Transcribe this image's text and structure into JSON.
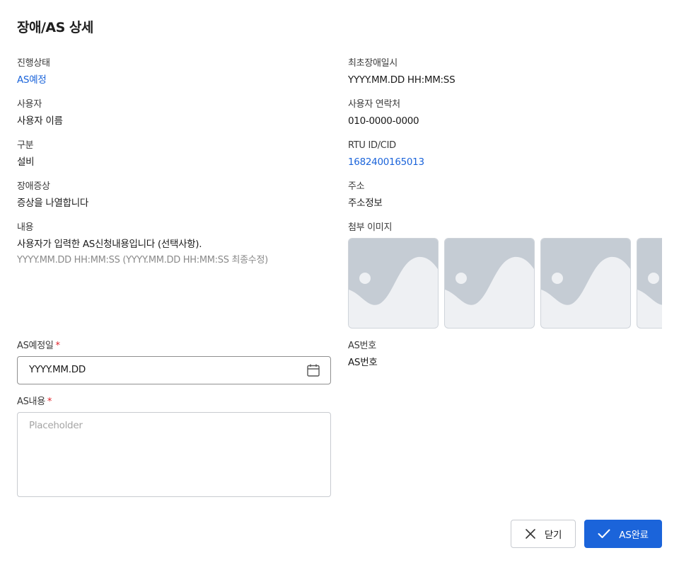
{
  "page_title": "장애/AS 상세",
  "left": {
    "status_label": "진행상태",
    "status_value": "AS예정",
    "user_label": "사용자",
    "user_value": "사용자 이름",
    "category_label": "구분",
    "category_value": "설비",
    "symptom_label": "장애증상",
    "symptom_value": "증상을 나열합니다",
    "content_label": "내용",
    "content_value": "사용자가 입력한 AS신청내용입니다 (선택사항).",
    "content_timestamp": "YYYY.MM.DD HH:MM:SS (YYYY.MM.DD HH:MM:SS 최종수정)"
  },
  "right": {
    "first_fault_label": "최초장애일시",
    "first_fault_value": "YYYY.MM.DD HH:MM:SS",
    "contact_label": "사용자 연락처",
    "contact_value": "010-0000-0000",
    "rtu_label": "RTU ID/CID",
    "rtu_value": "1682400165013",
    "address_label": "주소",
    "address_value": "주소정보",
    "attachments_label": "첨부 이미지",
    "attachments": [
      "image-placeholder",
      "image-placeholder",
      "image-placeholder",
      "image-placeholder"
    ],
    "as_number_label": "AS번호",
    "as_number_value": "AS번호"
  },
  "form": {
    "as_date_label": "AS예정일",
    "as_date_required": "*",
    "as_date_value": "YYYY.MM.DD",
    "as_content_label": "AS내용",
    "as_content_required": "*",
    "as_content_placeholder": "Placeholder"
  },
  "buttons": {
    "close_label": "닫기",
    "done_label": "AS완료"
  },
  "colors": {
    "accent": "#1b64da",
    "required": "#e0242a",
    "thumb_bg": "#eef0f3",
    "thumb_shape": "#c5ccd4"
  }
}
